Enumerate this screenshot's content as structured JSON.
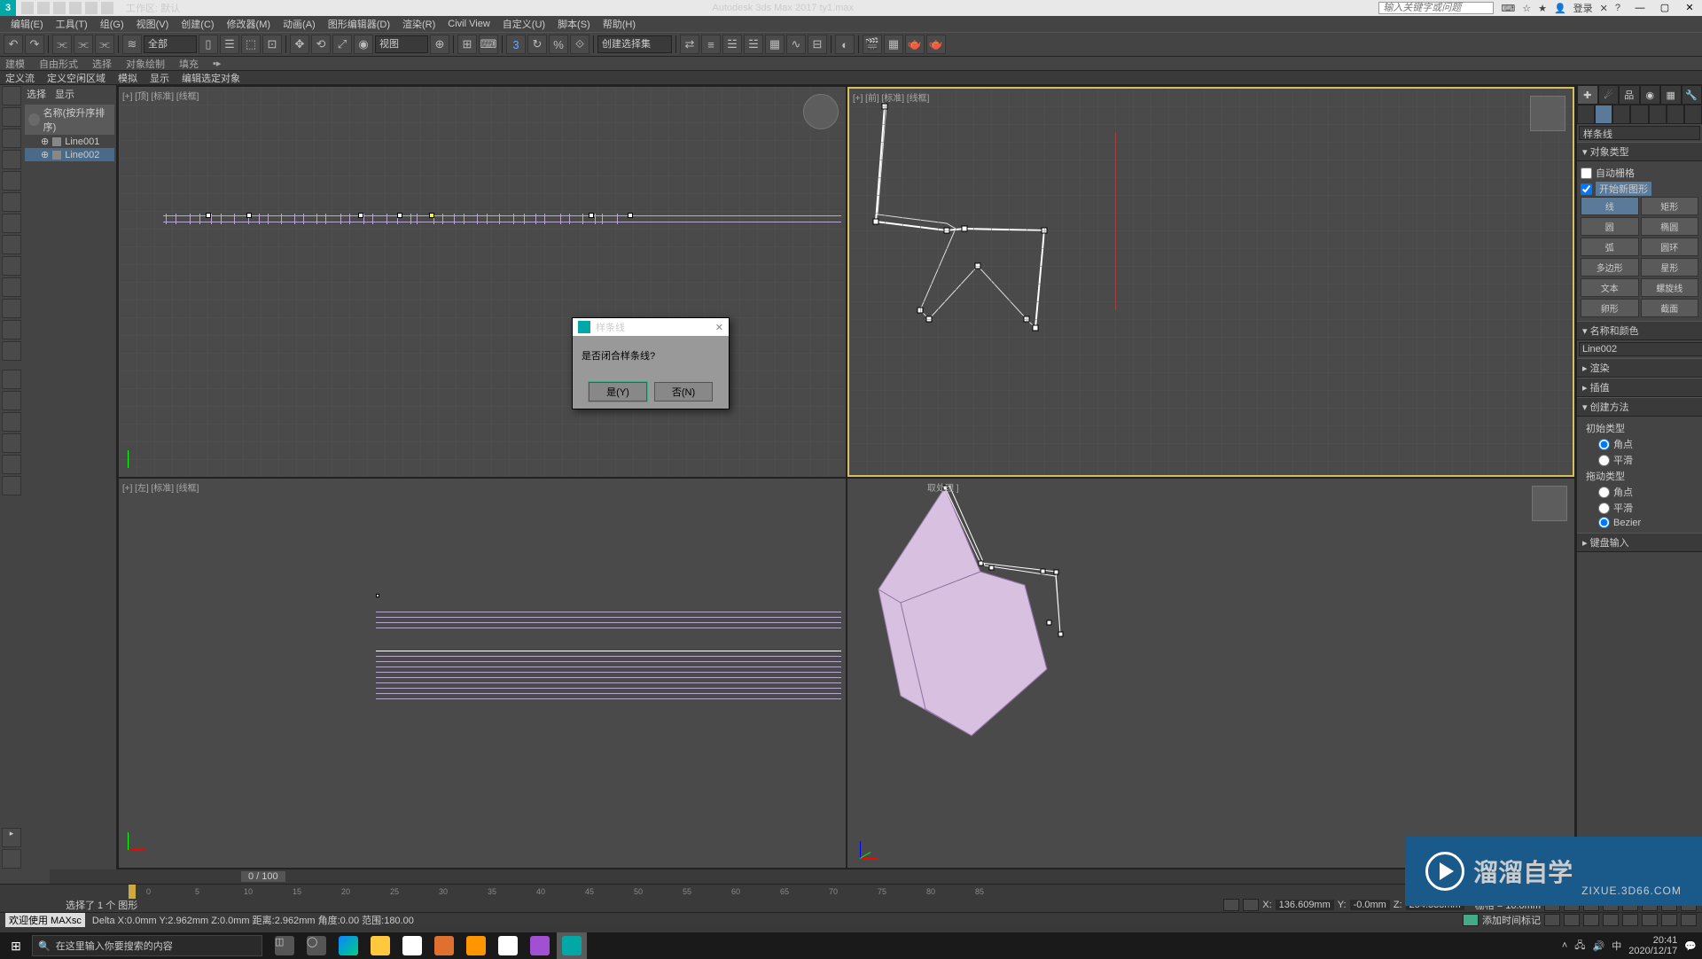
{
  "titlebar": {
    "workspace_label": "工作区: 默认",
    "app_title": "Autodesk 3ds Max 2017    ty1.max",
    "search_placeholder": "输入关键字或问题",
    "signin": "登录"
  },
  "menu": [
    "编辑(E)",
    "工具(T)",
    "组(G)",
    "视图(V)",
    "创建(C)",
    "修改器(M)",
    "动画(A)",
    "图形编辑器(D)",
    "渲染(R)",
    "Civil View",
    "自定义(U)",
    "脚本(S)",
    "帮助(H)"
  ],
  "toolbar_dd1": "全部",
  "toolbar_dd2": "视图",
  "toolbar_dd3": "创建选择集",
  "ribbon": [
    "建模",
    "自由形式",
    "选择",
    "对象绘制",
    "填充"
  ],
  "subribbon": [
    "定义流",
    "定义空闲区域",
    "模拟",
    "显示",
    "编辑选定对象"
  ],
  "scene": {
    "tabs": [
      "选择",
      "显示"
    ],
    "header": "名称(按升序排序)",
    "items": [
      "Line001",
      "Line002"
    ]
  },
  "viewports": {
    "top": "[+] [顶] [标准] [线框]",
    "front": "[+] [前] [标准] [线框]",
    "left": "[+] [左] [标准] [线框]",
    "persp": "取处理 ]"
  },
  "dialog": {
    "title": "样条线",
    "msg": "是否闭合样条线?",
    "yes": "是(Y)",
    "no": "否(N)"
  },
  "cmd": {
    "category": "样条线",
    "roll_objtype": "对象类型",
    "auto_grid": "自动栅格",
    "start_shape": "开始新图形",
    "objects": [
      "线",
      "矩形",
      "圆",
      "椭圆",
      "弧",
      "圆环",
      "多边形",
      "星形",
      "文本",
      "螺旋线",
      "卵形",
      "截面"
    ],
    "roll_name": "名称和颜色",
    "name_value": "Line002",
    "roll_render": "渲染",
    "roll_interp": "插值",
    "roll_method": "创建方法",
    "init_type": "初始类型",
    "r_corner": "角点",
    "r_smooth": "平滑",
    "drag_type": "拖动类型",
    "r_bezier": "Bezier",
    "roll_kbd": "键盘输入"
  },
  "timeslider": {
    "frame": "0 / 100"
  },
  "ruler_ticks": [
    "0",
    "5",
    "10",
    "15",
    "20",
    "25",
    "30",
    "35",
    "40",
    "45",
    "50",
    "55",
    "60",
    "65",
    "70",
    "75",
    "80",
    "85"
  ],
  "status": {
    "sel": "选择了 1 个 图形",
    "welcome": "欢迎使用  MAXsc",
    "delta": "Delta X:0.0mm  Y:2.962mm  Z:0.0mm  距离:2.962mm 角度:0.00 范围:180.00",
    "x_lbl": "X:",
    "x_val": "136.609mm",
    "y_lbl": "Y:",
    "y_val": "-0.0mm",
    "z_lbl": "Z:",
    "z_val": "254.338mm",
    "grid_lbl": "栅格 = 10.0mm",
    "addtime": "添加时间标记"
  },
  "watermark": {
    "brand": "溜溜自学",
    "url": "ZIXUE.3D66.COM"
  },
  "taskbar": {
    "search": "在这里输入你要搜索的内容",
    "time": "20:41",
    "date": "2020/12/17"
  }
}
